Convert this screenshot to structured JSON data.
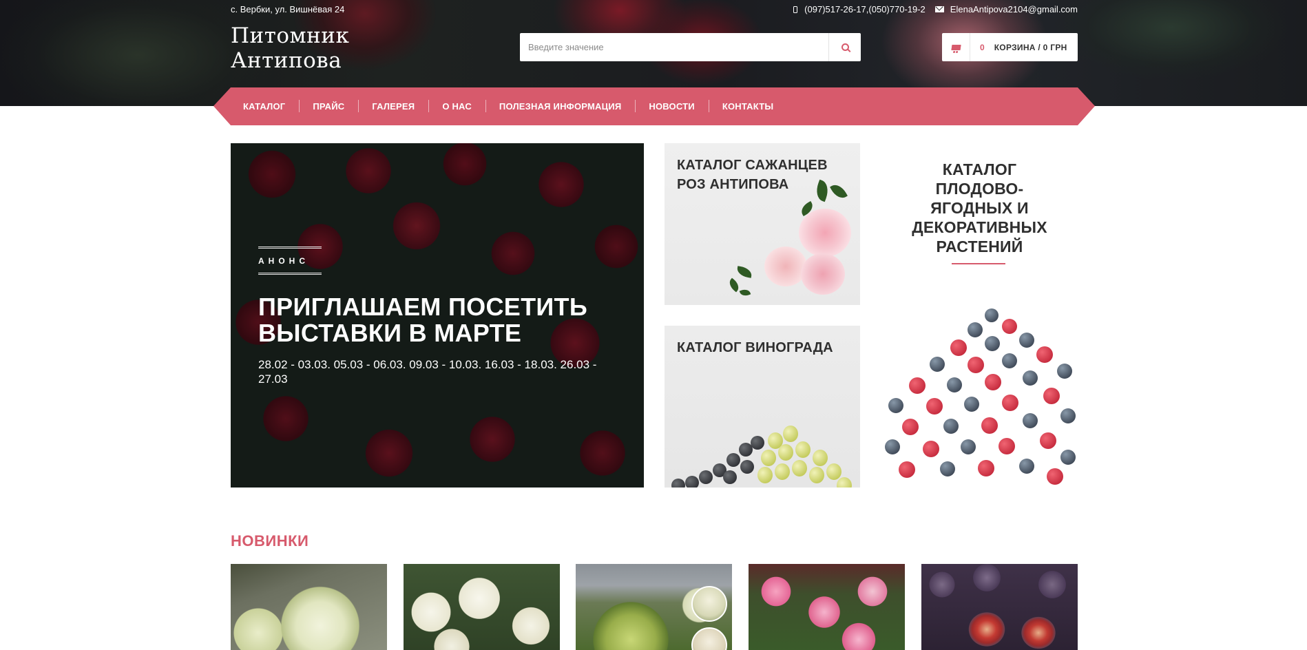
{
  "header": {
    "address": "с. Вербки, ул. Вишнёвая 24",
    "phone": "(097)517-26-17,(050)770-19-2",
    "email": "ElenaAntipova2104@gmail.com",
    "logo_line1": "Питомник",
    "logo_line2": "Антипова",
    "search_placeholder": "Введите значение",
    "search_icon": "search-icon",
    "cart": {
      "count": "0",
      "label": "КОРЗИНА / 0 ГРН",
      "icon": "cart-icon"
    }
  },
  "nav": {
    "items": [
      "КАТАЛОГ",
      "ПРАЙС",
      "ГАЛЕРЕЯ",
      "О НАС",
      "ПОЛЕЗНАЯ ИНФОРМАЦИЯ",
      "НОВОСТИ",
      "КОНТАКТЫ"
    ]
  },
  "hero": {
    "tag": "АНОНС",
    "title": "ПРИГЛАШАЕМ ПОСЕТИТЬ ВЫСТАВКИ В МАРТЕ",
    "dates": "28.02 - 03.03. 05.03 - 06.03. 09.03 - 10.03. 16.03 - 18.03. 26.03 - 27.03"
  },
  "tiles": {
    "roses": "КАТАЛОГ САЖАНЦЕВ РОЗ АНТИПОВА",
    "grapes": "КАТАЛОГ ВИНОГРАДА",
    "fruit": "КАТАЛОГ ПЛОДОВО-ЯГОДНЫХ И ДЕКОРАТИВНЫХ РАСТЕНИЙ"
  },
  "new_items": {
    "title": "НОВИНКИ"
  },
  "colors": {
    "accent": "#d75a6c",
    "text_dark": "#2f2f2f",
    "header_bg": "#1b1c20"
  }
}
